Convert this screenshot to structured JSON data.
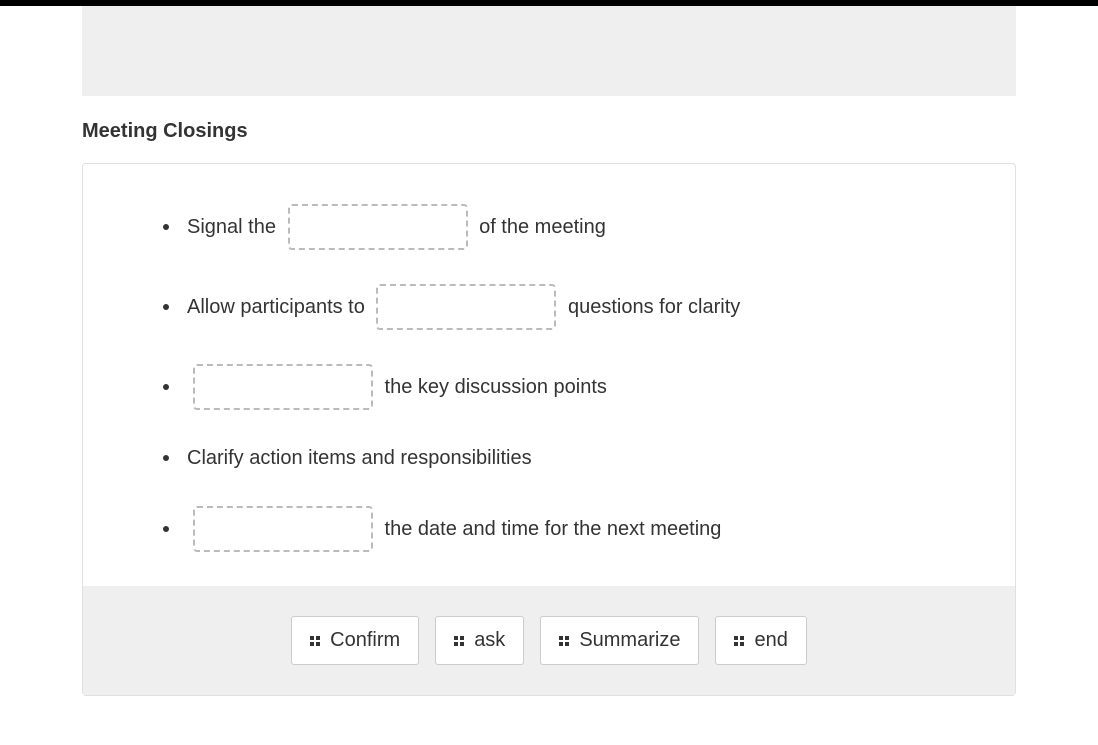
{
  "section": {
    "title": "Meeting Closings"
  },
  "items": [
    {
      "before": "Signal the ",
      "hasSlot": true,
      "after": " of the meeting"
    },
    {
      "before": "Allow participants to ",
      "hasSlot": true,
      "after": " questions for clarity"
    },
    {
      "before": "",
      "hasSlot": true,
      "after": " the key discussion points"
    },
    {
      "before": "Clarify action items and responsibilities",
      "hasSlot": false,
      "after": ""
    },
    {
      "before": "",
      "hasSlot": true,
      "after": " the date and time for the next meeting"
    }
  ],
  "answers": [
    {
      "label": "Confirm"
    },
    {
      "label": "ask"
    },
    {
      "label": "Summarize"
    },
    {
      "label": "end"
    }
  ]
}
